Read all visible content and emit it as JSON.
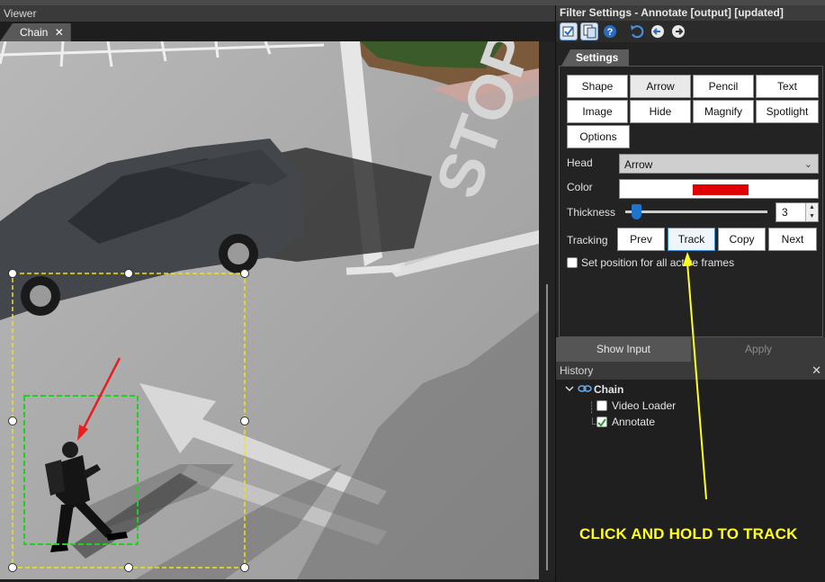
{
  "viewer": {
    "title": "Viewer",
    "tab": {
      "label": "Chain",
      "close": "✕"
    }
  },
  "filter_settings": {
    "title": "Filter Settings - Annotate [output] [updated]",
    "toolbar": [
      "check-icon",
      "copy-settings-icon",
      "help-icon",
      "undo-icon",
      "back-icon",
      "forward-icon"
    ],
    "tab": "Settings",
    "shape_buttons": [
      "Shape",
      "Arrow",
      "Pencil",
      "Text",
      "Image",
      "Hide",
      "Magnify",
      "Spotlight",
      "Options"
    ],
    "active_shape": "Arrow",
    "head": {
      "label": "Head",
      "value": "Arrow"
    },
    "color": {
      "label": "Color",
      "value": "#e00000"
    },
    "thickness": {
      "label": "Thickness",
      "value": "3"
    },
    "tracking": {
      "label": "Tracking",
      "buttons": [
        "Prev",
        "Track",
        "Copy",
        "Next"
      ]
    },
    "set_position_label": "Set position for all active frames",
    "set_position_checked": false,
    "show_input_label": "Show Input",
    "apply_label": "Apply"
  },
  "history": {
    "title": "History",
    "close": "✕",
    "root": "Chain",
    "items": [
      {
        "label": "Video Loader",
        "checked": false
      },
      {
        "label": "Annotate",
        "checked": true
      }
    ]
  },
  "callout": "CLICK AND HOLD TO TRACK",
  "colors": {
    "annotation_arrow": "#e62020",
    "selection_box": "#f0e020",
    "tracking_box": "#20d020",
    "callout_text": "#ffff1e",
    "accent_blue": "#1f74cc"
  }
}
